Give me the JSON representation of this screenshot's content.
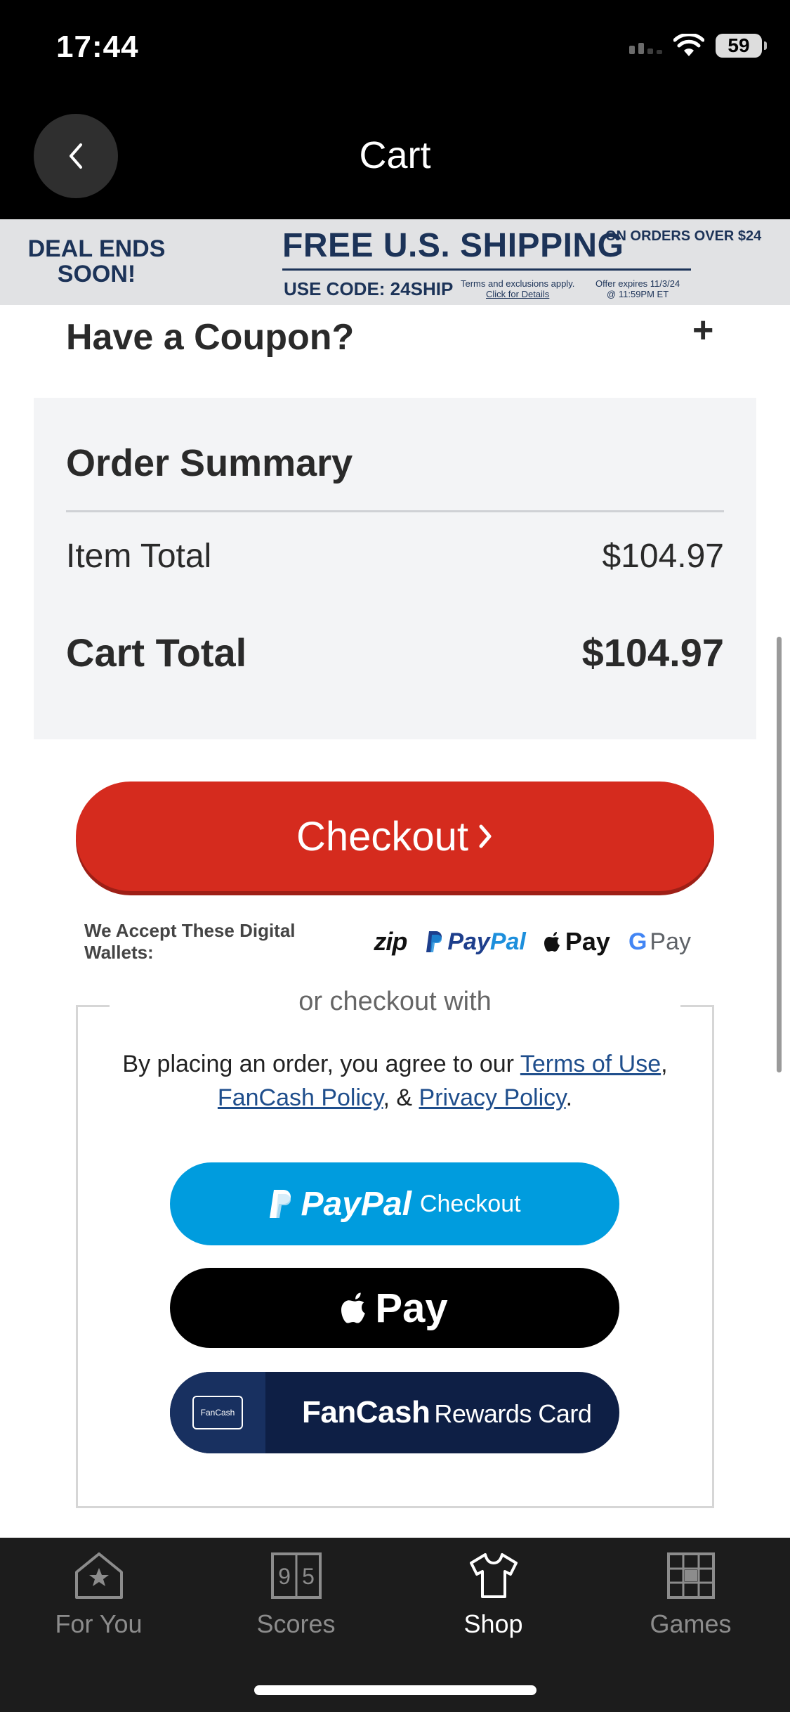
{
  "status_bar": {
    "time": "17:44",
    "battery": "59"
  },
  "header": {
    "title": "Cart"
  },
  "promo": {
    "deal": "DEAL ENDS SOON!",
    "headline": "FREE U.S. SHIPPING",
    "orders": "ON ORDERS OVER $24",
    "code": "USE CODE: 24SHIP",
    "terms": "Terms and exclusions apply.",
    "details_link": "Click for Details",
    "expiry_line1": "Offer expires 11/3/24",
    "expiry_line2": "@ 11:59PM ET"
  },
  "coupon": {
    "title": "Have a Coupon?",
    "toggle": "+"
  },
  "order_summary": {
    "title": "Order Summary",
    "item_total_label": "Item Total",
    "item_total_value": "$104.97",
    "cart_total_label": "Cart Total",
    "cart_total_value": "$104.97"
  },
  "checkout": {
    "label": "Checkout",
    "chevron": "›"
  },
  "wallets": {
    "label": "We Accept These Digital Wallets:",
    "zip": "zip",
    "paypal_pay": "Pay",
    "paypal_pal": "Pal",
    "apple_pay": "Pay",
    "google_g": "G",
    "google_pay": "Pay"
  },
  "alt_checkout": {
    "label": "or checkout with",
    "agree_prefix": "By placing an order, you agree to our ",
    "terms_link": "Terms of Use",
    "comma": ", ",
    "fancash_link": "FanCash Policy",
    "and": ", & ",
    "privacy_link": "Privacy Policy",
    "period": ".",
    "paypal_word": "PayPal",
    "paypal_checkout": "Checkout",
    "applepay_word": "Pay",
    "fancash_card_label": "FanCash",
    "fancash_word": "FanCash",
    "fancash_rewards": "Rewards Card"
  },
  "nav": {
    "items": [
      {
        "label": "For You",
        "icon": "house-star-icon",
        "active": false
      },
      {
        "label": "Scores",
        "icon": "scoreboard-icon",
        "active": false
      },
      {
        "label": "Shop",
        "icon": "shirt-icon",
        "active": true
      },
      {
        "label": "Games",
        "icon": "grid-icon",
        "active": false
      }
    ],
    "scores_icon_digits": [
      "9",
      "5"
    ]
  },
  "colors": {
    "checkout_red": "#d52b1e",
    "paypal_blue": "#009cde",
    "fancash_navy": "#0e1f45",
    "banner_navy": "#1c3358"
  }
}
